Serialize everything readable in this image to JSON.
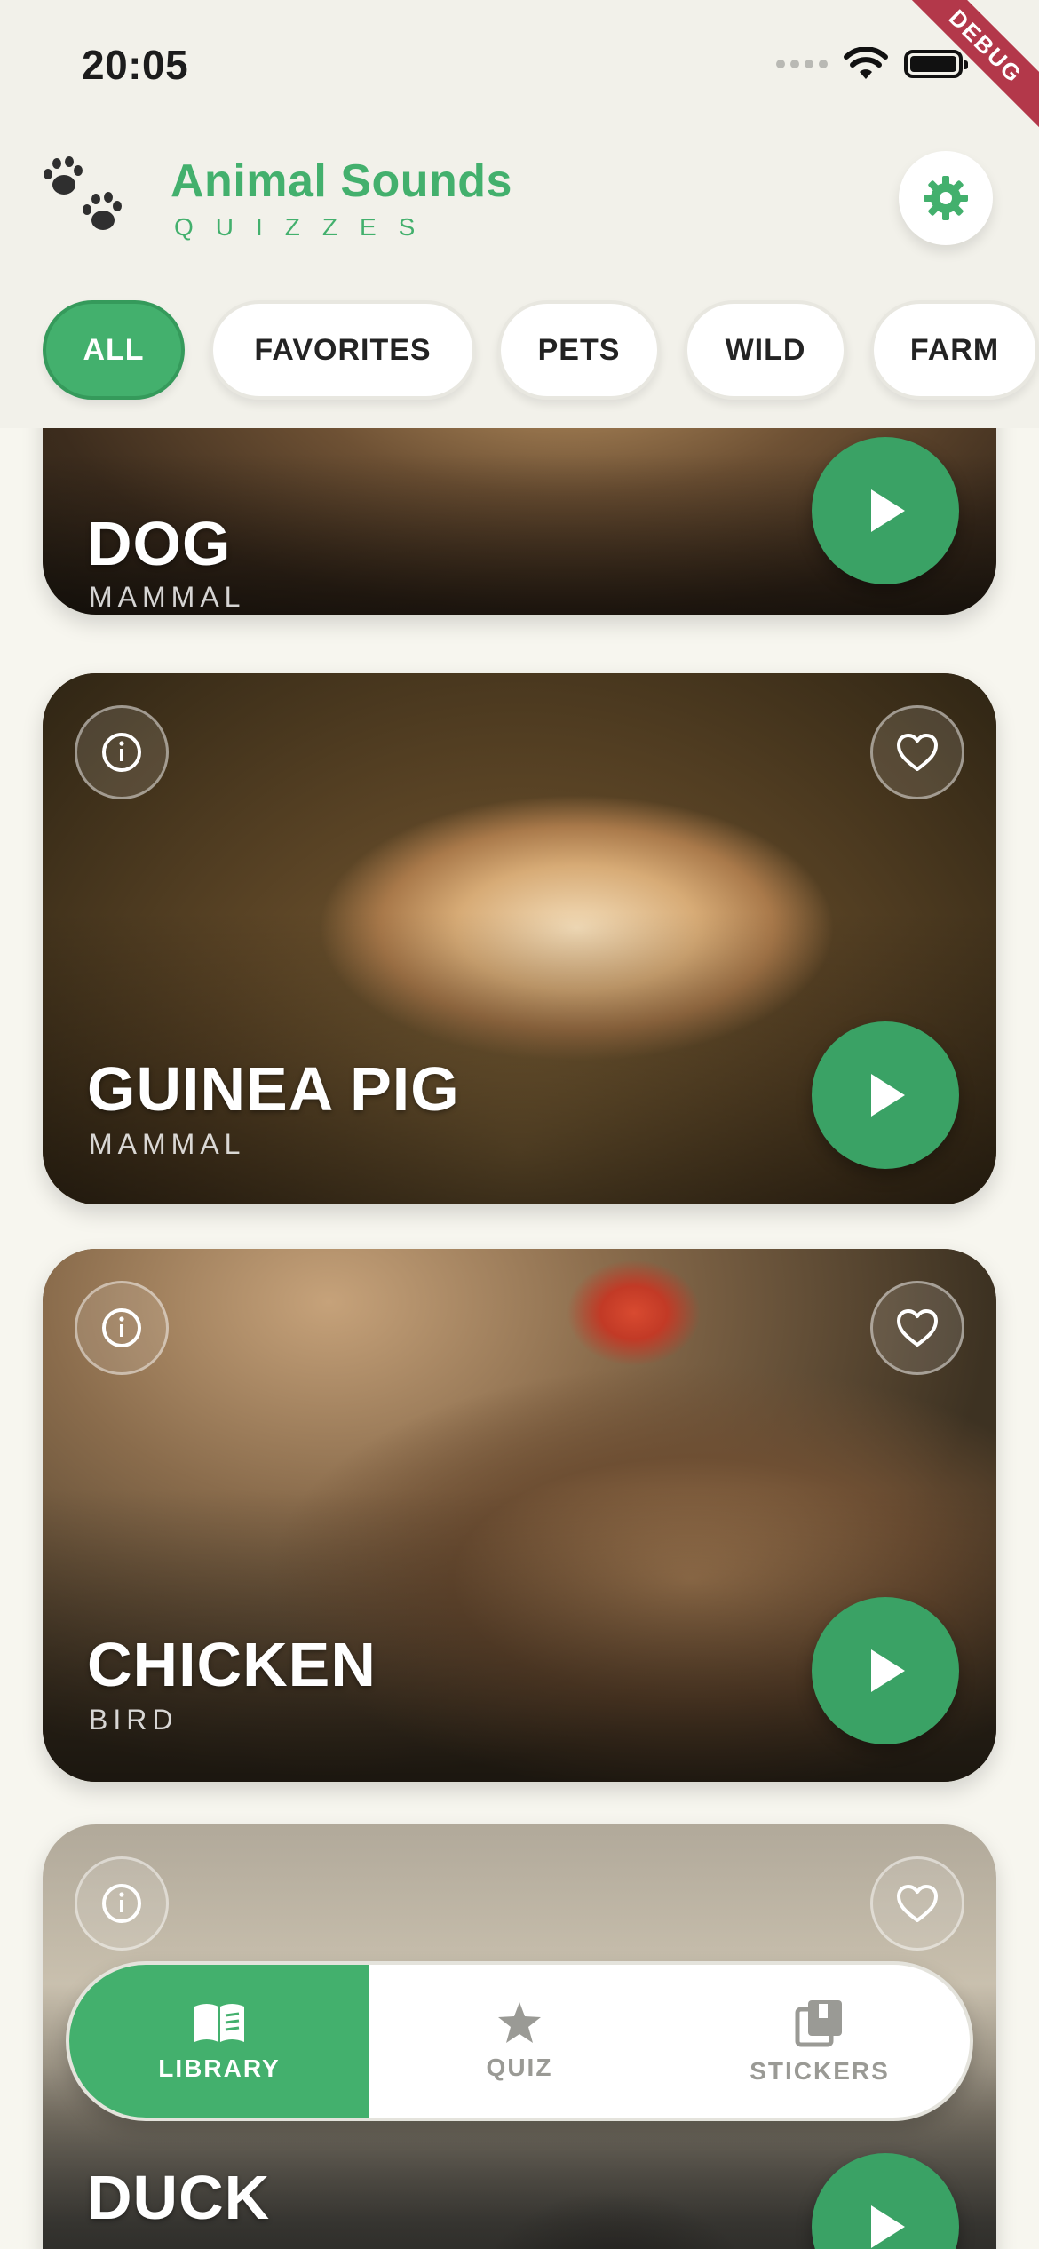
{
  "status_bar": {
    "time": "20:05"
  },
  "debug_banner": "DEBUG",
  "header": {
    "title": "Animal Sounds",
    "subtitle": "QUIZZES"
  },
  "filters": [
    {
      "label": "ALL",
      "active": true
    },
    {
      "label": "FAVORITES",
      "active": false
    },
    {
      "label": "PETS",
      "active": false
    },
    {
      "label": "WILD",
      "active": false
    },
    {
      "label": "FARM",
      "active": false
    }
  ],
  "cards": [
    {
      "name": "DOG",
      "category": "MAMMAL"
    },
    {
      "name": "GUINEA PIG",
      "category": "MAMMAL"
    },
    {
      "name": "CHICKEN",
      "category": "BIRD"
    },
    {
      "name": "DUCK",
      "category": ""
    }
  ],
  "bottom_nav": [
    {
      "label": "LIBRARY",
      "icon": "book-icon",
      "active": true
    },
    {
      "label": "QUIZ",
      "icon": "star-icon",
      "active": false
    },
    {
      "label": "STICKERS",
      "icon": "stickers-icon",
      "active": false
    }
  ],
  "colors": {
    "accent": "#43b06d",
    "play_button": "#3aa265",
    "background": "#f7f6ef"
  }
}
